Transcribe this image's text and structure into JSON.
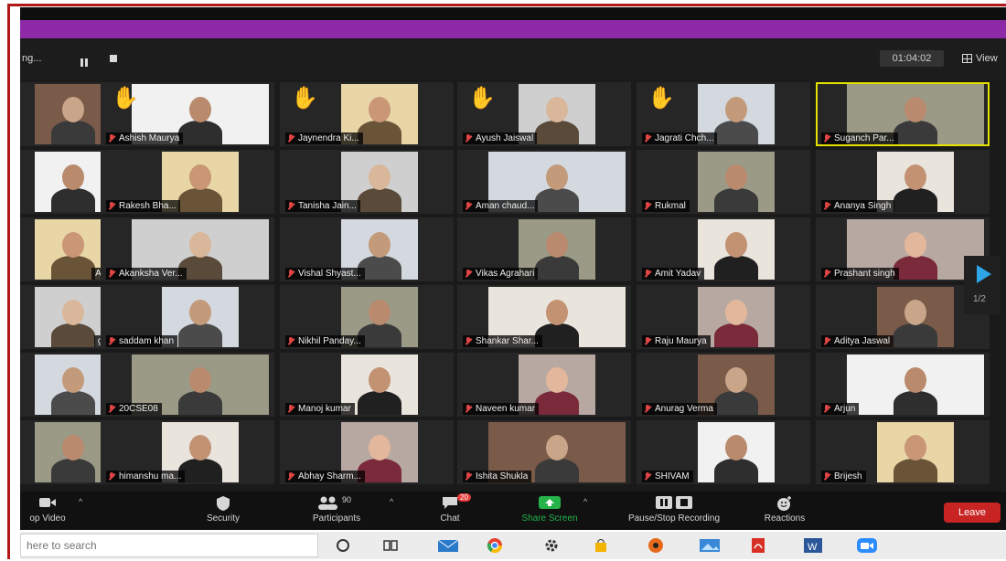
{
  "meeting": {
    "name": "ng...",
    "timer": "01:04:02",
    "view_label": "View"
  },
  "participants": [
    {
      "name": "",
      "hand": false,
      "active": false
    },
    {
      "name": "Ashish Maurya",
      "hand": true,
      "active": false
    },
    {
      "name": "Jaynendra Ki...",
      "hand": true,
      "active": false
    },
    {
      "name": "Ayush Jaiswal",
      "hand": true,
      "active": false
    },
    {
      "name": "Jagrati Chch...",
      "hand": true,
      "active": false
    },
    {
      "name": "Suganch Par...",
      "hand": false,
      "active": true
    },
    {
      "name": "",
      "hand": false,
      "active": false
    },
    {
      "name": "Rakesh Bha...",
      "hand": false,
      "active": false
    },
    {
      "name": "Tanisha Jain...",
      "hand": false,
      "active": false
    },
    {
      "name": "Aman chaud...",
      "hand": false,
      "active": false
    },
    {
      "name": "Rukmal",
      "hand": false,
      "active": false
    },
    {
      "name": "Ananya Singh",
      "hand": false,
      "active": false
    },
    {
      "name": "AR",
      "hand": false,
      "active": false
    },
    {
      "name": "Akanksha Ver...",
      "hand": false,
      "active": false
    },
    {
      "name": "Vishal Shyast...",
      "hand": false,
      "active": false
    },
    {
      "name": "Vikas Agrahari",
      "hand": false,
      "active": false
    },
    {
      "name": "Amit Yadav",
      "hand": false,
      "active": false
    },
    {
      "name": "Prashant singh",
      "hand": false,
      "active": false
    },
    {
      "name": "gh",
      "hand": false,
      "active": false
    },
    {
      "name": "saddam khan",
      "hand": false,
      "active": false
    },
    {
      "name": "Nikhil Panday...",
      "hand": false,
      "active": false
    },
    {
      "name": "Shankar Shar...",
      "hand": false,
      "active": false
    },
    {
      "name": "Raju Maurya",
      "hand": false,
      "active": false
    },
    {
      "name": "Aditya Jaswal",
      "hand": false,
      "active": false
    },
    {
      "name": "",
      "hand": false,
      "active": false
    },
    {
      "name": "20CSE08",
      "hand": false,
      "active": false
    },
    {
      "name": "Manoj kumar",
      "hand": false,
      "active": false
    },
    {
      "name": "Naveen kumar",
      "hand": false,
      "active": false
    },
    {
      "name": "Anurag Verma",
      "hand": false,
      "active": false
    },
    {
      "name": "Arjun",
      "hand": false,
      "active": false
    },
    {
      "name": "",
      "hand": false,
      "active": false
    },
    {
      "name": "himanshu ma...",
      "hand": false,
      "active": false
    },
    {
      "name": "Abhay Sharm...",
      "hand": false,
      "active": false
    },
    {
      "name": "Ishita Shukla",
      "hand": false,
      "active": false
    },
    {
      "name": "SHIVAM",
      "hand": false,
      "active": false
    },
    {
      "name": "Brijesh",
      "hand": false,
      "active": false
    }
  ],
  "pagination": "1/2",
  "controls": {
    "video": "op Video",
    "security": "Security",
    "participants": "Participants",
    "participants_count": "90",
    "chat": "Chat",
    "chat_badge": "20",
    "share": "Share Screen",
    "record": "Pause/Stop Recording",
    "reactions": "Reactions",
    "leave": "Leave"
  },
  "taskbar": {
    "search_placeholder": "here to search"
  },
  "colors": {
    "accent_purple": "#8e2aa8",
    "active_border": "#e6e200",
    "leave_red": "#c82424",
    "share_green": "#25b34a"
  }
}
